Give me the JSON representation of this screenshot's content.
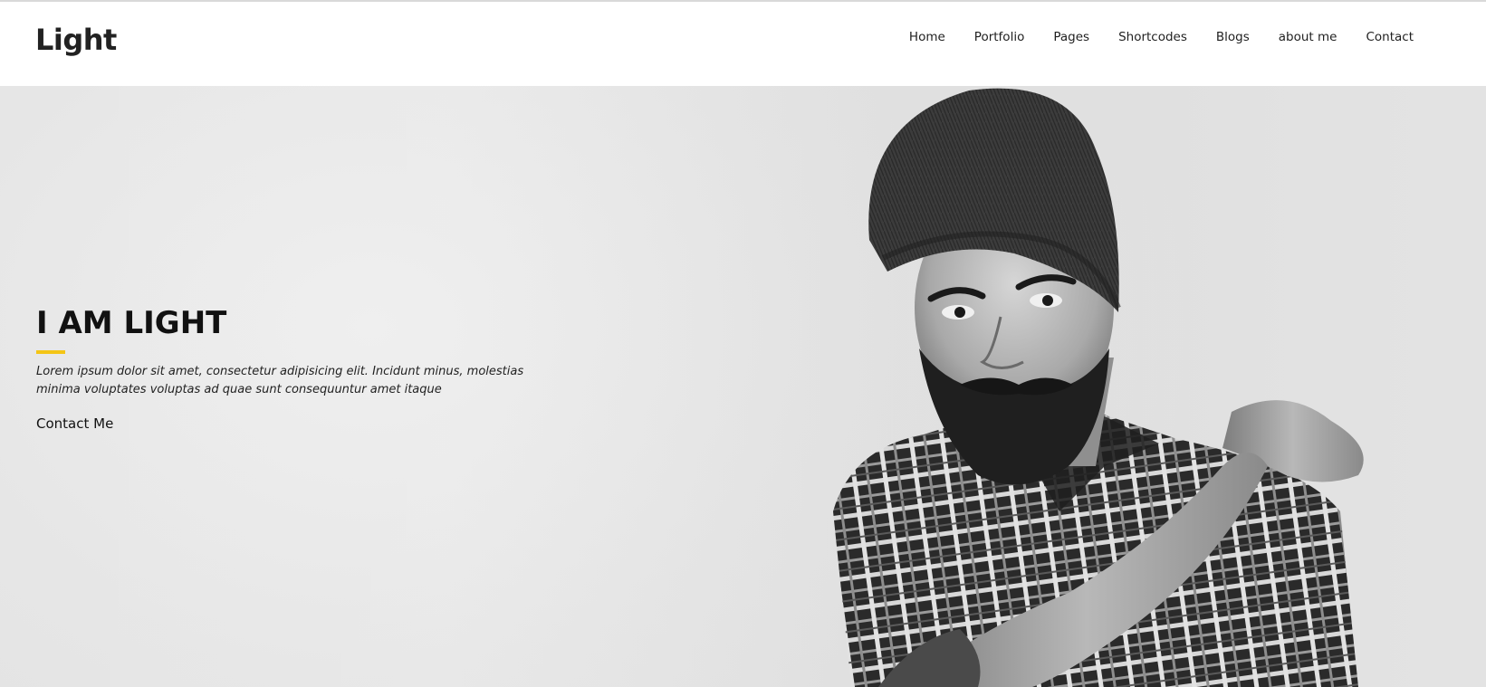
{
  "brand": {
    "logo_text": "Light"
  },
  "nav": {
    "items": [
      {
        "label": "Home"
      },
      {
        "label": "Portfolio"
      },
      {
        "label": "Pages"
      },
      {
        "label": "Shortcodes"
      },
      {
        "label": "Blogs"
      },
      {
        "label": "about me"
      },
      {
        "label": "Contact"
      }
    ]
  },
  "hero": {
    "title": "I AM LIGHT",
    "description": "Lorem ipsum dolor sit amet, consectetur adipisicing elit. Incidunt minus, molestias minima voluptates voluptas ad quae sunt consequuntur amet itaque",
    "button_label": "Contact Me",
    "accent_color": "#f4c516",
    "image_subject": "portrait of bearded man in knit beanie and plaid shirt"
  },
  "colors": {
    "text_dark": "#111111",
    "header_bg": "#ffffff",
    "hero_bg": "#e8e8e8"
  }
}
